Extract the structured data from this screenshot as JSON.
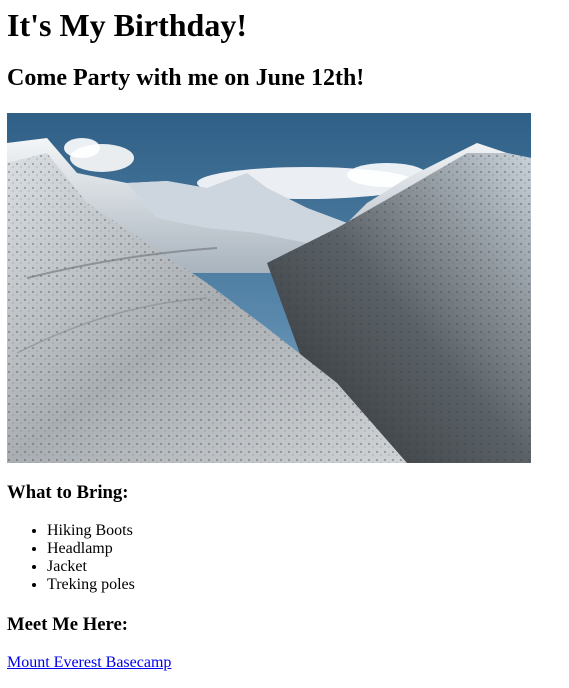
{
  "page": {
    "title": "It's My Birthday!",
    "subtitle": "Come Party with me on June 12th!"
  },
  "hero_image": {
    "icon": "mountain-landscape-photo"
  },
  "bring": {
    "heading": "What to Bring:",
    "items": [
      "Hiking Boots",
      "Headlamp",
      "Jacket",
      "Treking poles"
    ]
  },
  "meet": {
    "heading": "Meet Me Here:",
    "link_text": "Mount Everest Basecamp"
  },
  "colors": {
    "link": "#0000ee",
    "sky": "#3f6f96",
    "snow": "#e8eef3",
    "rock": "#3a3f44"
  }
}
